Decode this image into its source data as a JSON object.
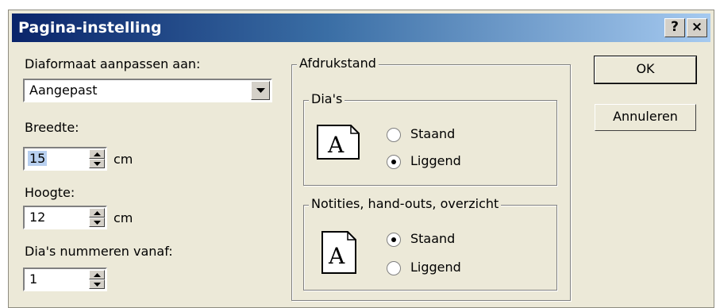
{
  "window": {
    "title": "Pagina-instelling",
    "help_label": "?",
    "close_label": "×"
  },
  "size": {
    "label": "Diaformaat aanpassen aan:",
    "selected": "Aangepast"
  },
  "width": {
    "label": "Breedte:",
    "value": "15",
    "unit": "cm"
  },
  "height": {
    "label": "Hoogte:",
    "value": "12",
    "unit": "cm"
  },
  "numbering": {
    "label": "Dia's nummeren vanaf:",
    "value": "1"
  },
  "orientation": {
    "title": "Afdrukstand",
    "slides": {
      "title": "Dia's",
      "options": [
        {
          "label": "Staand",
          "checked": false
        },
        {
          "label": "Liggend",
          "checked": true
        }
      ]
    },
    "notes": {
      "title": "Notities, hand-outs, overzicht",
      "options": [
        {
          "label": "Staand",
          "checked": true
        },
        {
          "label": "Liggend",
          "checked": false
        }
      ]
    }
  },
  "buttons": {
    "ok": "OK",
    "cancel": "Annuleren"
  },
  "icon_glyph": "A"
}
